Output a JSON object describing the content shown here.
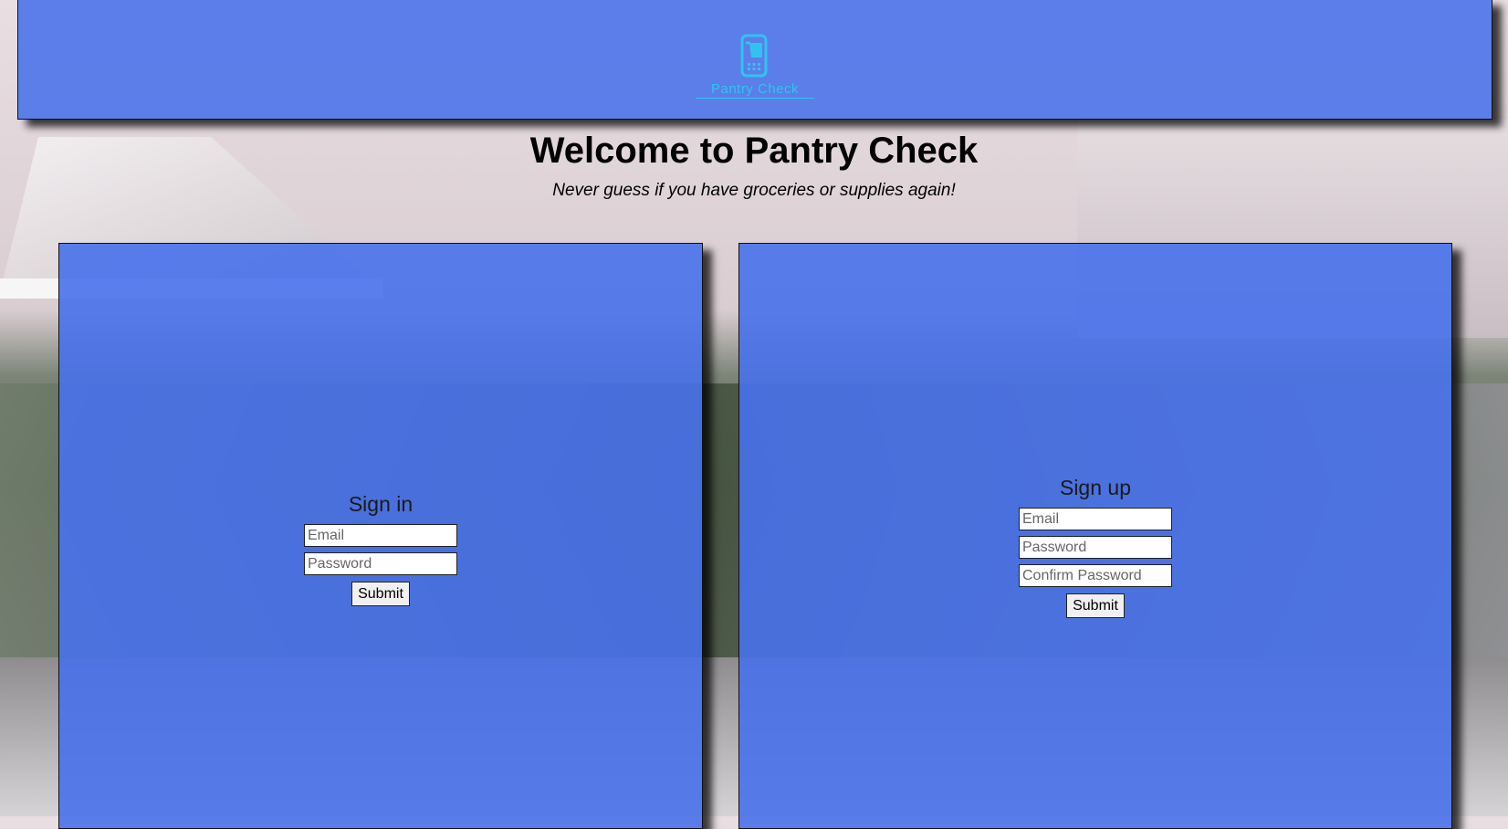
{
  "header": {
    "logo_text": "Pantry Check"
  },
  "hero": {
    "title": "Welcome to Pantry Check",
    "subtitle": "Never guess if you have groceries or supplies again!"
  },
  "signin": {
    "heading": "Sign in",
    "email_placeholder": "Email",
    "password_placeholder": "Password",
    "submit_label": "Submit"
  },
  "signup": {
    "heading": "Sign up",
    "email_placeholder": "Email",
    "password_placeholder": "Password",
    "confirm_placeholder": "Confirm Password",
    "submit_label": "Submit"
  },
  "colors": {
    "panel_blue": "#4871eb",
    "logo_cyan": "#31c3ef"
  },
  "icons": {
    "logo": "phone-cart-icon"
  }
}
